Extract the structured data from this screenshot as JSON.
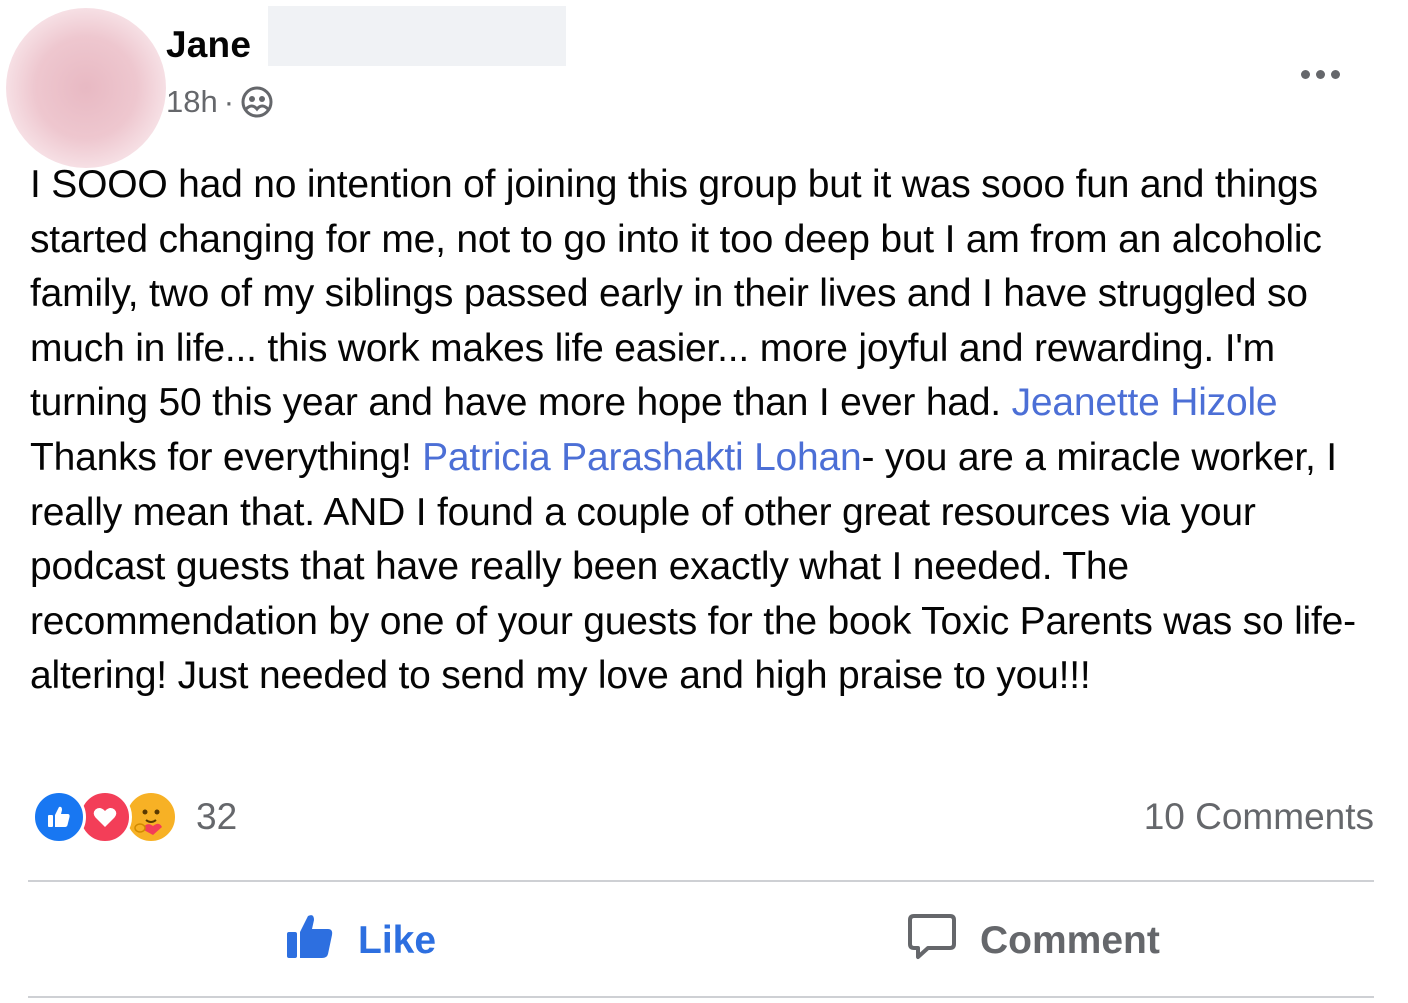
{
  "post": {
    "author": "Jane",
    "timestamp": "18h",
    "meta_separator": "·",
    "audience_icon": "group-members-icon",
    "text_parts": {
      "p1": "I SOOO had no intention of joining this group but it was sooo fun and things started changing for me, not to go into it too deep but I am from an alcoholic family, two of my siblings passed early in their lives and I have struggled so much in life... this work makes life easier... more joyful and rewarding. I'm turning 50 this year and have more hope than I ever had. ",
      "mention1": "Jeanette Hizole",
      "p2": " Thanks for everything! ",
      "mention2": "Patricia Parashakti Lohan",
      "p3": "- you are a miracle worker, I really mean that. AND I found a couple of other great resources via your podcast guests that have really been exactly what I needed. The recommendation by one of your guests for the book Toxic Parents was so life-altering! Just needed to send my love and high praise to you!!!"
    },
    "reactions": {
      "types": [
        "like-icon",
        "love-icon",
        "care-icon"
      ],
      "count": "32"
    },
    "comments_label": "10 Comments",
    "actions": {
      "like": "Like",
      "comment": "Comment"
    }
  },
  "colors": {
    "mention": "#4c6fd6",
    "like_blue": "#1877f2",
    "love_red": "#f33e58",
    "care_yellow": "#f7b125",
    "secondary_text": "#65676b"
  }
}
